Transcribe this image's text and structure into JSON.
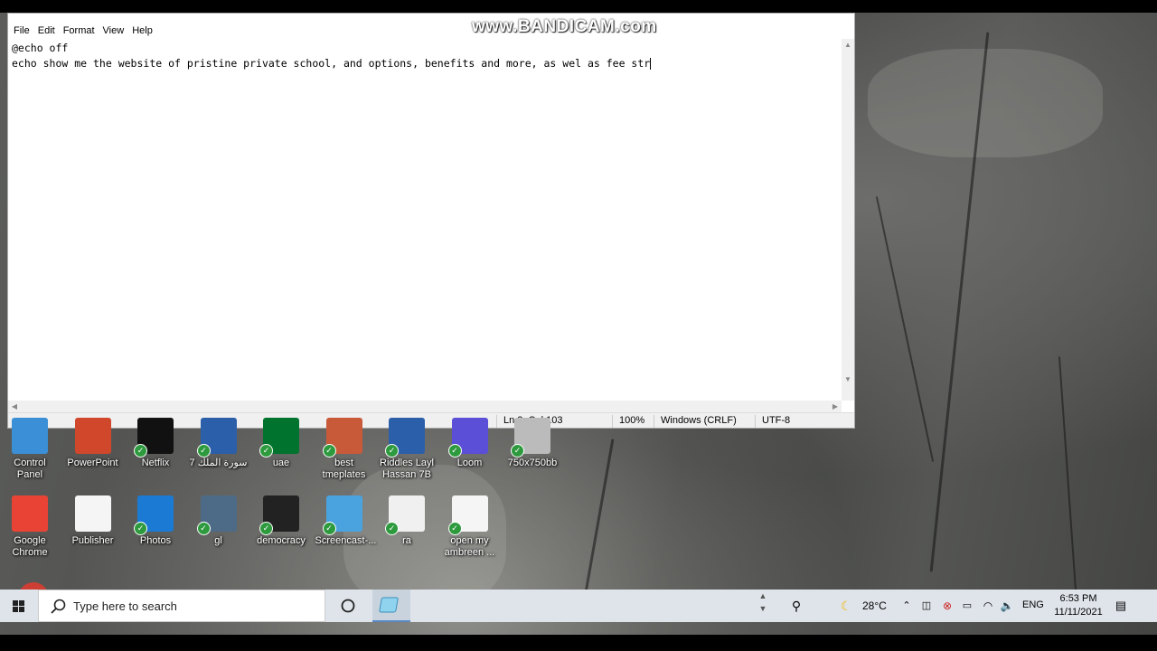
{
  "watermark": "www.BANDICAM.com",
  "notepad": {
    "menu": [
      "File",
      "Edit",
      "Format",
      "View",
      "Help"
    ],
    "lines": [
      "@echo off",
      "echo show me the website of pristine private school, and options, benefits and more, as wel as fee str"
    ],
    "status": {
      "position": "Ln 2, Col 103",
      "zoom": "100%",
      "line_ending": "Windows (CRLF)",
      "encoding": "UTF-8"
    }
  },
  "desktop_icons_row1": [
    {
      "label": "Control Panel",
      "icon": "control-panel-icon",
      "color": "#3b8fd6"
    },
    {
      "label": "PowerPoint",
      "icon": "powerpoint-icon",
      "color": "#d0472b"
    },
    {
      "label": "Netflix",
      "icon": "netflix-icon",
      "color": "#111111"
    },
    {
      "label": "7 سورة الملك",
      "icon": "word-doc-icon",
      "color": "#2b5faa"
    },
    {
      "label": "uae",
      "icon": "uae-flag-icon",
      "color": "#00732f"
    },
    {
      "label": "best tmeplates",
      "icon": "powerpoint-file-icon",
      "color": "#c85a3a"
    },
    {
      "label": "Riddles Layl Hassan 7B",
      "icon": "word-doc-icon",
      "color": "#2b5faa"
    },
    {
      "label": "Loom",
      "icon": "loom-icon",
      "color": "#5a4fd6"
    },
    {
      "label": "750x750bb",
      "icon": "image-file-icon",
      "color": "#bbbbbb"
    }
  ],
  "desktop_icons_row2": [
    {
      "label": "Google Chrome",
      "icon": "chrome-icon",
      "color": "#e94335"
    },
    {
      "label": "Publisher",
      "icon": "document-icon",
      "color": "#f5f5f5"
    },
    {
      "label": "Photos",
      "icon": "photos-icon",
      "color": "#1b7ad3"
    },
    {
      "label": "gl",
      "icon": "image-file-icon",
      "color": "#4d6b87"
    },
    {
      "label": "democracy",
      "icon": "image-file-icon",
      "color": "#222222"
    },
    {
      "label": "Screencast-...",
      "icon": "screencast-icon",
      "color": "#4aa3df"
    },
    {
      "label": "ra",
      "icon": "text-file-icon",
      "color": "#f0f0f0"
    },
    {
      "label": "open my ambreen ...",
      "icon": "document-icon",
      "color": "#f5f5f5"
    }
  ],
  "taskbar": {
    "search_placeholder": "Type here to search",
    "weather": "28°C",
    "language": "ENG",
    "time": "6:53 PM",
    "date": "11/11/2021"
  },
  "colors": {
    "taskbar_bg": "#dfe4ea",
    "notepad_bg": "#ffffff",
    "record": "#e23a2e"
  }
}
